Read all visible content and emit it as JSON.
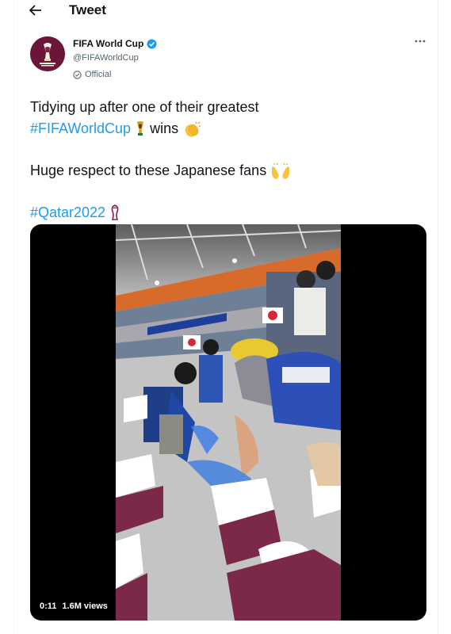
{
  "header": {
    "title": "Tweet",
    "back_icon": "arrow-left-icon"
  },
  "author": {
    "name": "FIFA World Cup",
    "handle": "@FIFAWorldCup",
    "label": "Official",
    "verified_icon": "verified-badge-icon",
    "avatar_bg": "#6b1538"
  },
  "tweet": {
    "line1": "Tidying up after one of their greatest",
    "hashtag1": "#FIFAWorldCup",
    "line2_tail": "wins",
    "line3": "Huge respect to these Japanese fans",
    "hashtag2": "#Qatar2022"
  },
  "video": {
    "duration": "0:11",
    "views": "1.6M views"
  },
  "colors": {
    "link": "#1d9bf0",
    "text": "#0f1419",
    "secondary": "#536471"
  }
}
